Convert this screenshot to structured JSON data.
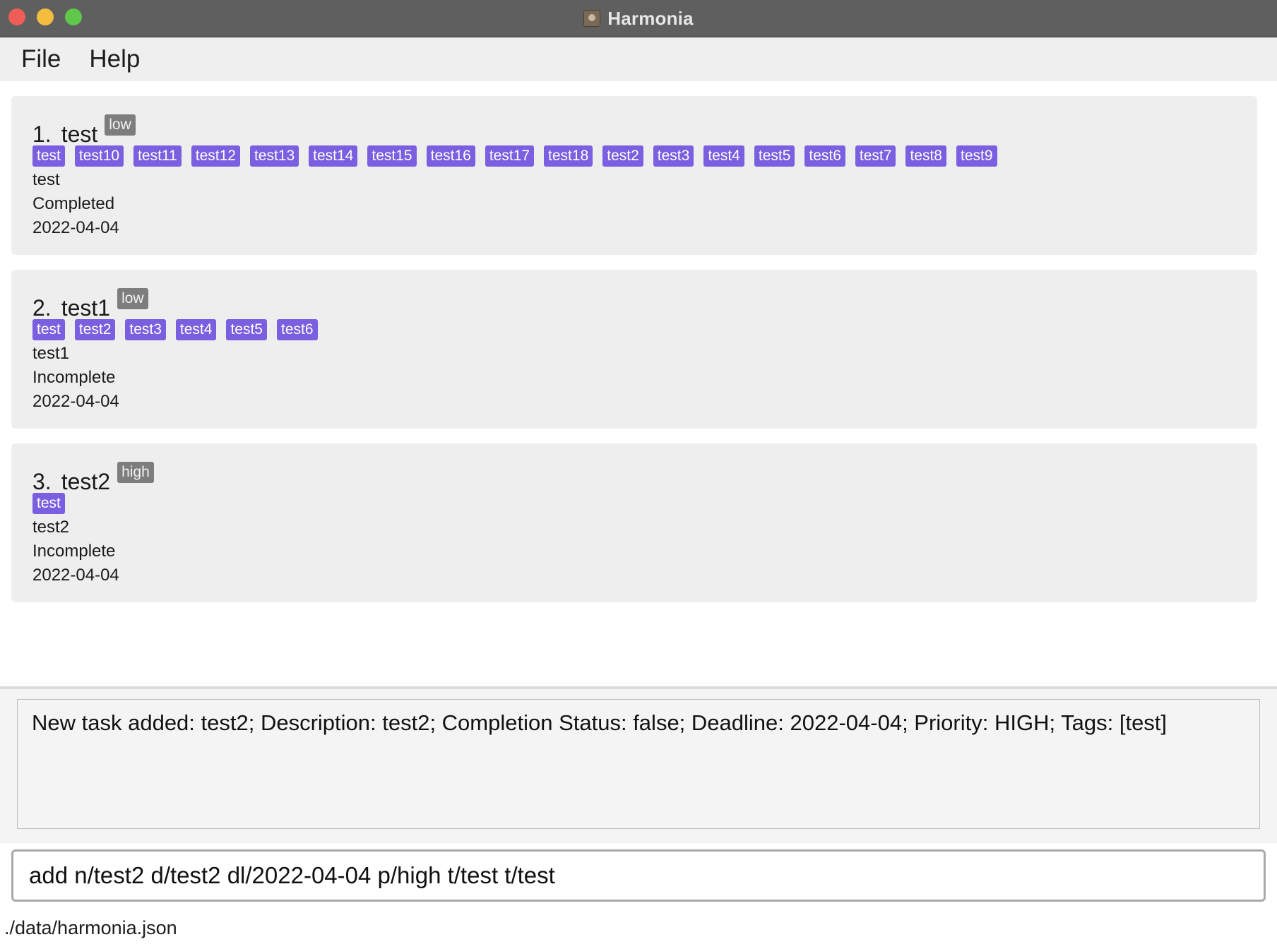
{
  "window": {
    "title": "Harmonia",
    "app_icon": "harmonia-app-icon"
  },
  "menubar": {
    "items": [
      {
        "label": "File"
      },
      {
        "label": "Help"
      }
    ]
  },
  "tasks": [
    {
      "index": "1.",
      "name": "test",
      "priority": "low",
      "tags": [
        "test",
        "test10",
        "test11",
        "test12",
        "test13",
        "test14",
        "test15",
        "test16",
        "test17",
        "test18",
        "test2",
        "test3",
        "test4",
        "test5",
        "test6",
        "test7",
        "test8",
        "test9"
      ],
      "description": "test",
      "status": "Completed",
      "deadline": "2022-04-04"
    },
    {
      "index": "2.",
      "name": "test1",
      "priority": "low",
      "tags": [
        "test",
        "test2",
        "test3",
        "test4",
        "test5",
        "test6"
      ],
      "description": "test1",
      "status": "Incomplete",
      "deadline": "2022-04-04"
    },
    {
      "index": "3.",
      "name": "test2",
      "priority": "high",
      "tags": [
        "test"
      ],
      "description": "test2",
      "status": "Incomplete",
      "deadline": "2022-04-04"
    }
  ],
  "result": {
    "text": "New task added: test2; Description: test2; Completion Status: false; Deadline: 2022-04-04; Priority: HIGH; Tags: [test]"
  },
  "command": {
    "value": "add n/test2 d/test2 dl/2022-04-04 p/high t/test t/test"
  },
  "statusbar": {
    "path": "./data/harmonia.json"
  },
  "colors": {
    "tag_bg": "#7a5fe0",
    "priority_bg": "#7d7d7d",
    "titlebar_bg": "#5f5f5f"
  }
}
